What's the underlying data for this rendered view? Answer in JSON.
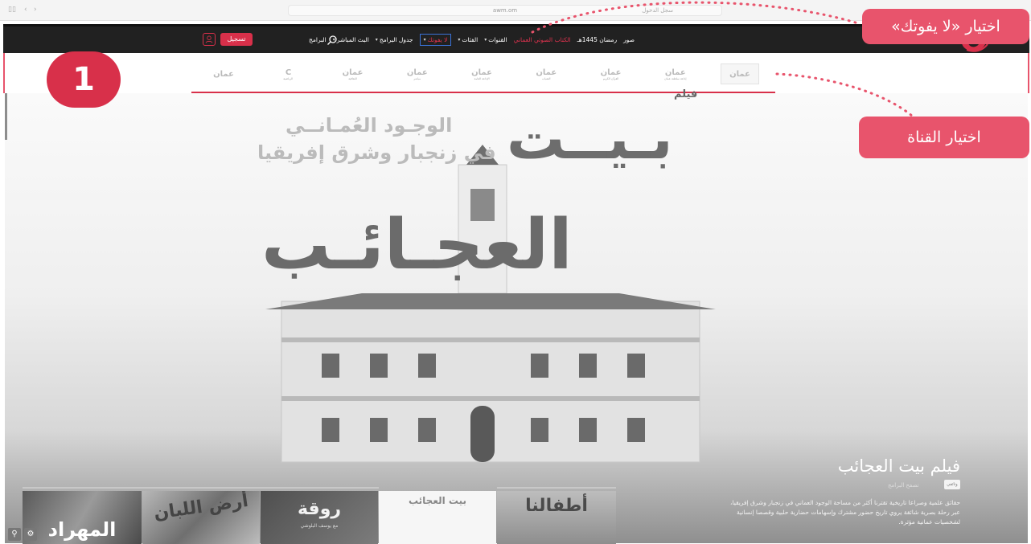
{
  "browser": {
    "url": "awm.om",
    "secondary": "سجل الدخول"
  },
  "header": {
    "logo": "logo",
    "nav": [
      {
        "label": "البرامج",
        "caret": false,
        "style": "normal"
      },
      {
        "label": "البث المباشر",
        "caret": true,
        "style": "normal"
      },
      {
        "label": "جدول البرامج",
        "caret": true,
        "style": "normal"
      },
      {
        "label": "لا يفوتك",
        "caret": true,
        "style": "active"
      },
      {
        "label": "الفئات",
        "caret": true,
        "style": "normal"
      },
      {
        "label": "القنوات",
        "caret": true,
        "style": "normal"
      },
      {
        "label": "الكتاب الصوتي العماني",
        "caret": false,
        "style": "red"
      },
      {
        "label": "رمضان 1445هـ",
        "caret": false,
        "style": "normal"
      },
      {
        "label": "صور",
        "caret": false,
        "style": "normal"
      }
    ],
    "register_label": "تسجيل",
    "icons": {
      "search": "search-icon",
      "user": "user-icon"
    }
  },
  "channels": [
    {
      "name": "عمان",
      "sub": ""
    },
    {
      "name": "C",
      "sub": "الرياضية"
    },
    {
      "name": "عمان",
      "sub": "الثقافية"
    },
    {
      "name": "عمان",
      "sub": "مباشر"
    },
    {
      "name": "عمان",
      "sub": "الإذاعة العامة"
    },
    {
      "name": "عمان",
      "sub": "الشباب"
    },
    {
      "name": "عمان",
      "sub": "القرآن الكريم"
    },
    {
      "name": "عمان",
      "sub": "إذاعة سلطنة عمان"
    },
    {
      "name": "عمان",
      "sub": ""
    }
  ],
  "hero": {
    "film_tag": "فيلم",
    "big_title_1": "بـيــت",
    "big_title_2": "العجـائـب",
    "subtitle_1": "الوجـود العُمـانــي",
    "subtitle_2": "في زنجبار وشرق إفريقيا"
  },
  "detail": {
    "title": "فيلم بيت العجائب",
    "genre_badge": "وثائقي",
    "genre_label": "تصفح البرامج",
    "description": "حقائق علمية وصراعا تاريخية تقترنا أكثر من مساحة الوجود العماني في زنجبار وشرق إفريقيا، عبر رحلة بصرية شائقة يروي تاريخ حضور مشترك وإسهامات حضارية حلبية وقصصا إنسانية لشخصيات عمانية مؤثرة."
  },
  "carousel": [
    {
      "title": "المهراد",
      "sub": ""
    },
    {
      "title": "أرض اللبان",
      "sub": ""
    },
    {
      "title": "روقة",
      "sub": "مع يوسف البلوشي"
    },
    {
      "title": "بيت العجائب",
      "sub": ""
    },
    {
      "title": "أطفالنا",
      "sub": ""
    }
  ],
  "carousel_icons": [
    "quality-icon",
    "settings-icon"
  ],
  "annotations": {
    "step_number": "1",
    "callout_dont_miss": "اختيار «لا يفوتك»",
    "callout_channel": "اختيار القناة"
  },
  "colors": {
    "accent": "#d8304a",
    "callout": "#e8546c",
    "header_bg": "#212121"
  }
}
